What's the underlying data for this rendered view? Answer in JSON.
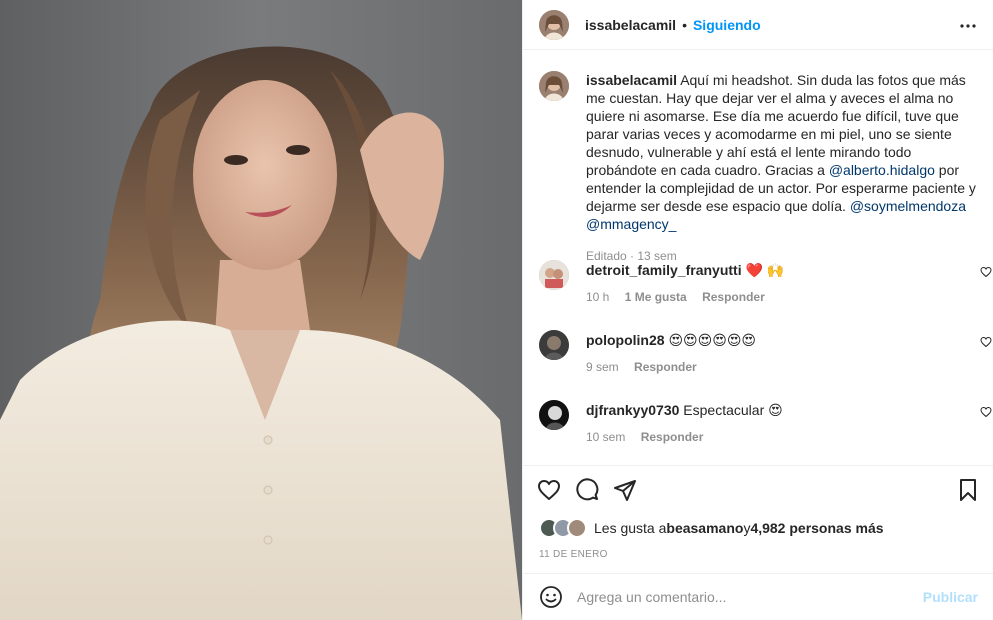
{
  "post": {
    "username": "issabelacamil",
    "dot": "•",
    "follow_label": "Siguiendo"
  },
  "caption": {
    "username": "issabelacamil",
    "text_part1": "Aquí mi headshot. Sin duda las fotos que más me cuestan. Hay que dejar ver el alma y aveces el alma no quiere ni asomarse. Ese día me acuerdo fue difícil, tuve que parar varias veces y acomodarme en mi piel, uno se siente desnudo, vulnerable y ahí está el lente mirando todo probándote en cada cuadro. Gracias a ",
    "mention1": "@alberto.hidalgo",
    "text_part2": " por entender la complejidad de un actor. Por esperarme paciente y dejarme ser desde ese espacio que dolía. ",
    "mention2": "@soymelmendoza",
    "space": " ",
    "mention3": "@mmagency_",
    "meta": "Editado · 13 sem"
  },
  "comments": [
    {
      "username": "detroit_family_franyutti",
      "text": "❤️ 🙌",
      "time": "10 h",
      "likes": "1 Me gusta",
      "reply": "Responder"
    },
    {
      "username": "polopolin28",
      "text": "😍😍😍😍😍😍",
      "time": "9 sem",
      "likes": "",
      "reply": "Responder"
    },
    {
      "username": "djfrankyy0730",
      "text": "Espectacular 😍",
      "time": "10 sem",
      "likes": "",
      "reply": "Responder"
    }
  ],
  "likes": {
    "prefix": "Les gusta a ",
    "user": "beasamano",
    "suffix": " y ",
    "count": "4,982 personas más"
  },
  "date": "11 DE ENERO",
  "add_comment": {
    "placeholder": "Agrega un comentario...",
    "publish_label": "Publicar"
  },
  "icons": {
    "more": "more-icon",
    "like": "heart-icon",
    "comment": "comment-icon",
    "share": "share-icon",
    "save": "bookmark-icon",
    "emoji": "emoji-icon"
  },
  "colors": {
    "accent": "#0095f6",
    "mention": "#00376b",
    "muted": "#8e8e8e",
    "publish_disabled": "#b2dffc",
    "heart_red": "#ed4956"
  }
}
